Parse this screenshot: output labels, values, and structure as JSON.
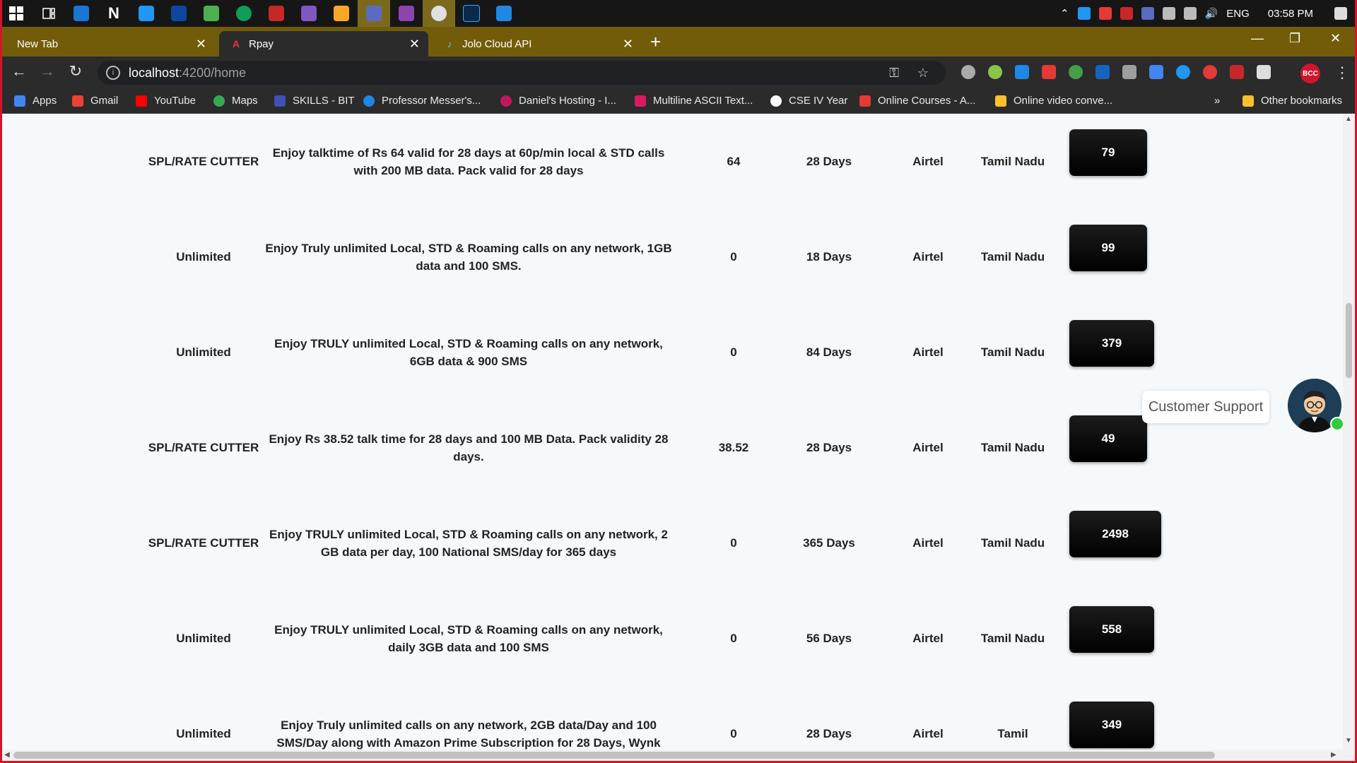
{
  "taskbar": {
    "icons": [
      "start-icon",
      "task-view-icon",
      "app-icon-1",
      "notion-icon",
      "app-icon-3",
      "app-icon-4",
      "app-icon-5",
      "edge-icon",
      "app-icon-7",
      "visual-studio-icon",
      "file-explorer-icon",
      "teams-icon",
      "visual-studio-2-icon",
      "chrome-icon",
      "photoshop-icon",
      "vscode-icon"
    ],
    "lang": "ENG",
    "time": "03:58 PM"
  },
  "tabs": [
    {
      "label": "New Tab",
      "close": "✕"
    },
    {
      "label": "Rpay",
      "close": "✕"
    },
    {
      "label": "Jolo Cloud API",
      "close": "✕"
    }
  ],
  "toolbar": {
    "url_host": "localhost",
    "url_path": ":4200/home"
  },
  "bookmarks": {
    "items": [
      "Apps",
      "Gmail",
      "YouTube",
      "Maps",
      "SKILLS - BIT",
      "Professor Messer's...",
      "Daniel's Hosting - I...",
      "Multiline ASCII Text...",
      "CSE IV Year",
      "Online Courses - A...",
      "Online video conve..."
    ],
    "overflow": "»",
    "other": "Other bookmarks"
  },
  "plans": [
    {
      "type": "SPL/RATE CUTTER",
      "description": "Enjoy talktime of Rs 64 valid for 28 days at 60p/min local & STD calls with 200 MB data. Pack valid for 28 days",
      "talktime": "64",
      "validity": "28 Days",
      "operator": "Airtel",
      "circle": "Tamil Nadu",
      "price": "79"
    },
    {
      "type": "Unlimited",
      "description": "Enjoy Truly unlimited Local, STD & Roaming calls on any network, 1GB data and 100 SMS.",
      "talktime": "0",
      "validity": "18 Days",
      "operator": "Airtel",
      "circle": "Tamil Nadu",
      "price": "99"
    },
    {
      "type": "Unlimited",
      "description": "Enjoy TRULY unlimited Local, STD & Roaming calls on any network, 6GB data & 900 SMS",
      "talktime": "0",
      "validity": "84 Days",
      "operator": "Airtel",
      "circle": "Tamil Nadu",
      "price": "379"
    },
    {
      "type": "SPL/RATE CUTTER",
      "description": "Enjoy Rs 38.52 talk time for 28 days and 100 MB Data. Pack validity 28 days.",
      "talktime": "38.52",
      "validity": "28 Days",
      "operator": "Airtel",
      "circle": "Tamil Nadu",
      "price": "49"
    },
    {
      "type": "SPL/RATE CUTTER",
      "description": "Enjoy TRULY unlimited Local, STD & Roaming calls on any network, 2 GB data per day, 100 National SMS/day for 365 days",
      "talktime": "0",
      "validity": "365 Days",
      "operator": "Airtel",
      "circle": "Tamil Nadu",
      "price": "2498"
    },
    {
      "type": "Unlimited",
      "description": "Enjoy TRULY unlimited Local, STD & Roaming calls on any network, daily 3GB data and 100 SMS",
      "talktime": "0",
      "validity": "56 Days",
      "operator": "Airtel",
      "circle": "Tamil Nadu",
      "price": "558"
    },
    {
      "type": "Unlimited",
      "description": "Enjoy Truly unlimited calls on any network, 2GB data/Day and 100 SMS/Day along with Amazon Prime Subscription for 28 Days, Wynk",
      "talktime": "0",
      "validity": "28 Days",
      "operator": "Airtel",
      "circle": "Tamil",
      "price": "349"
    }
  ],
  "support": {
    "label": "Customer Support"
  }
}
